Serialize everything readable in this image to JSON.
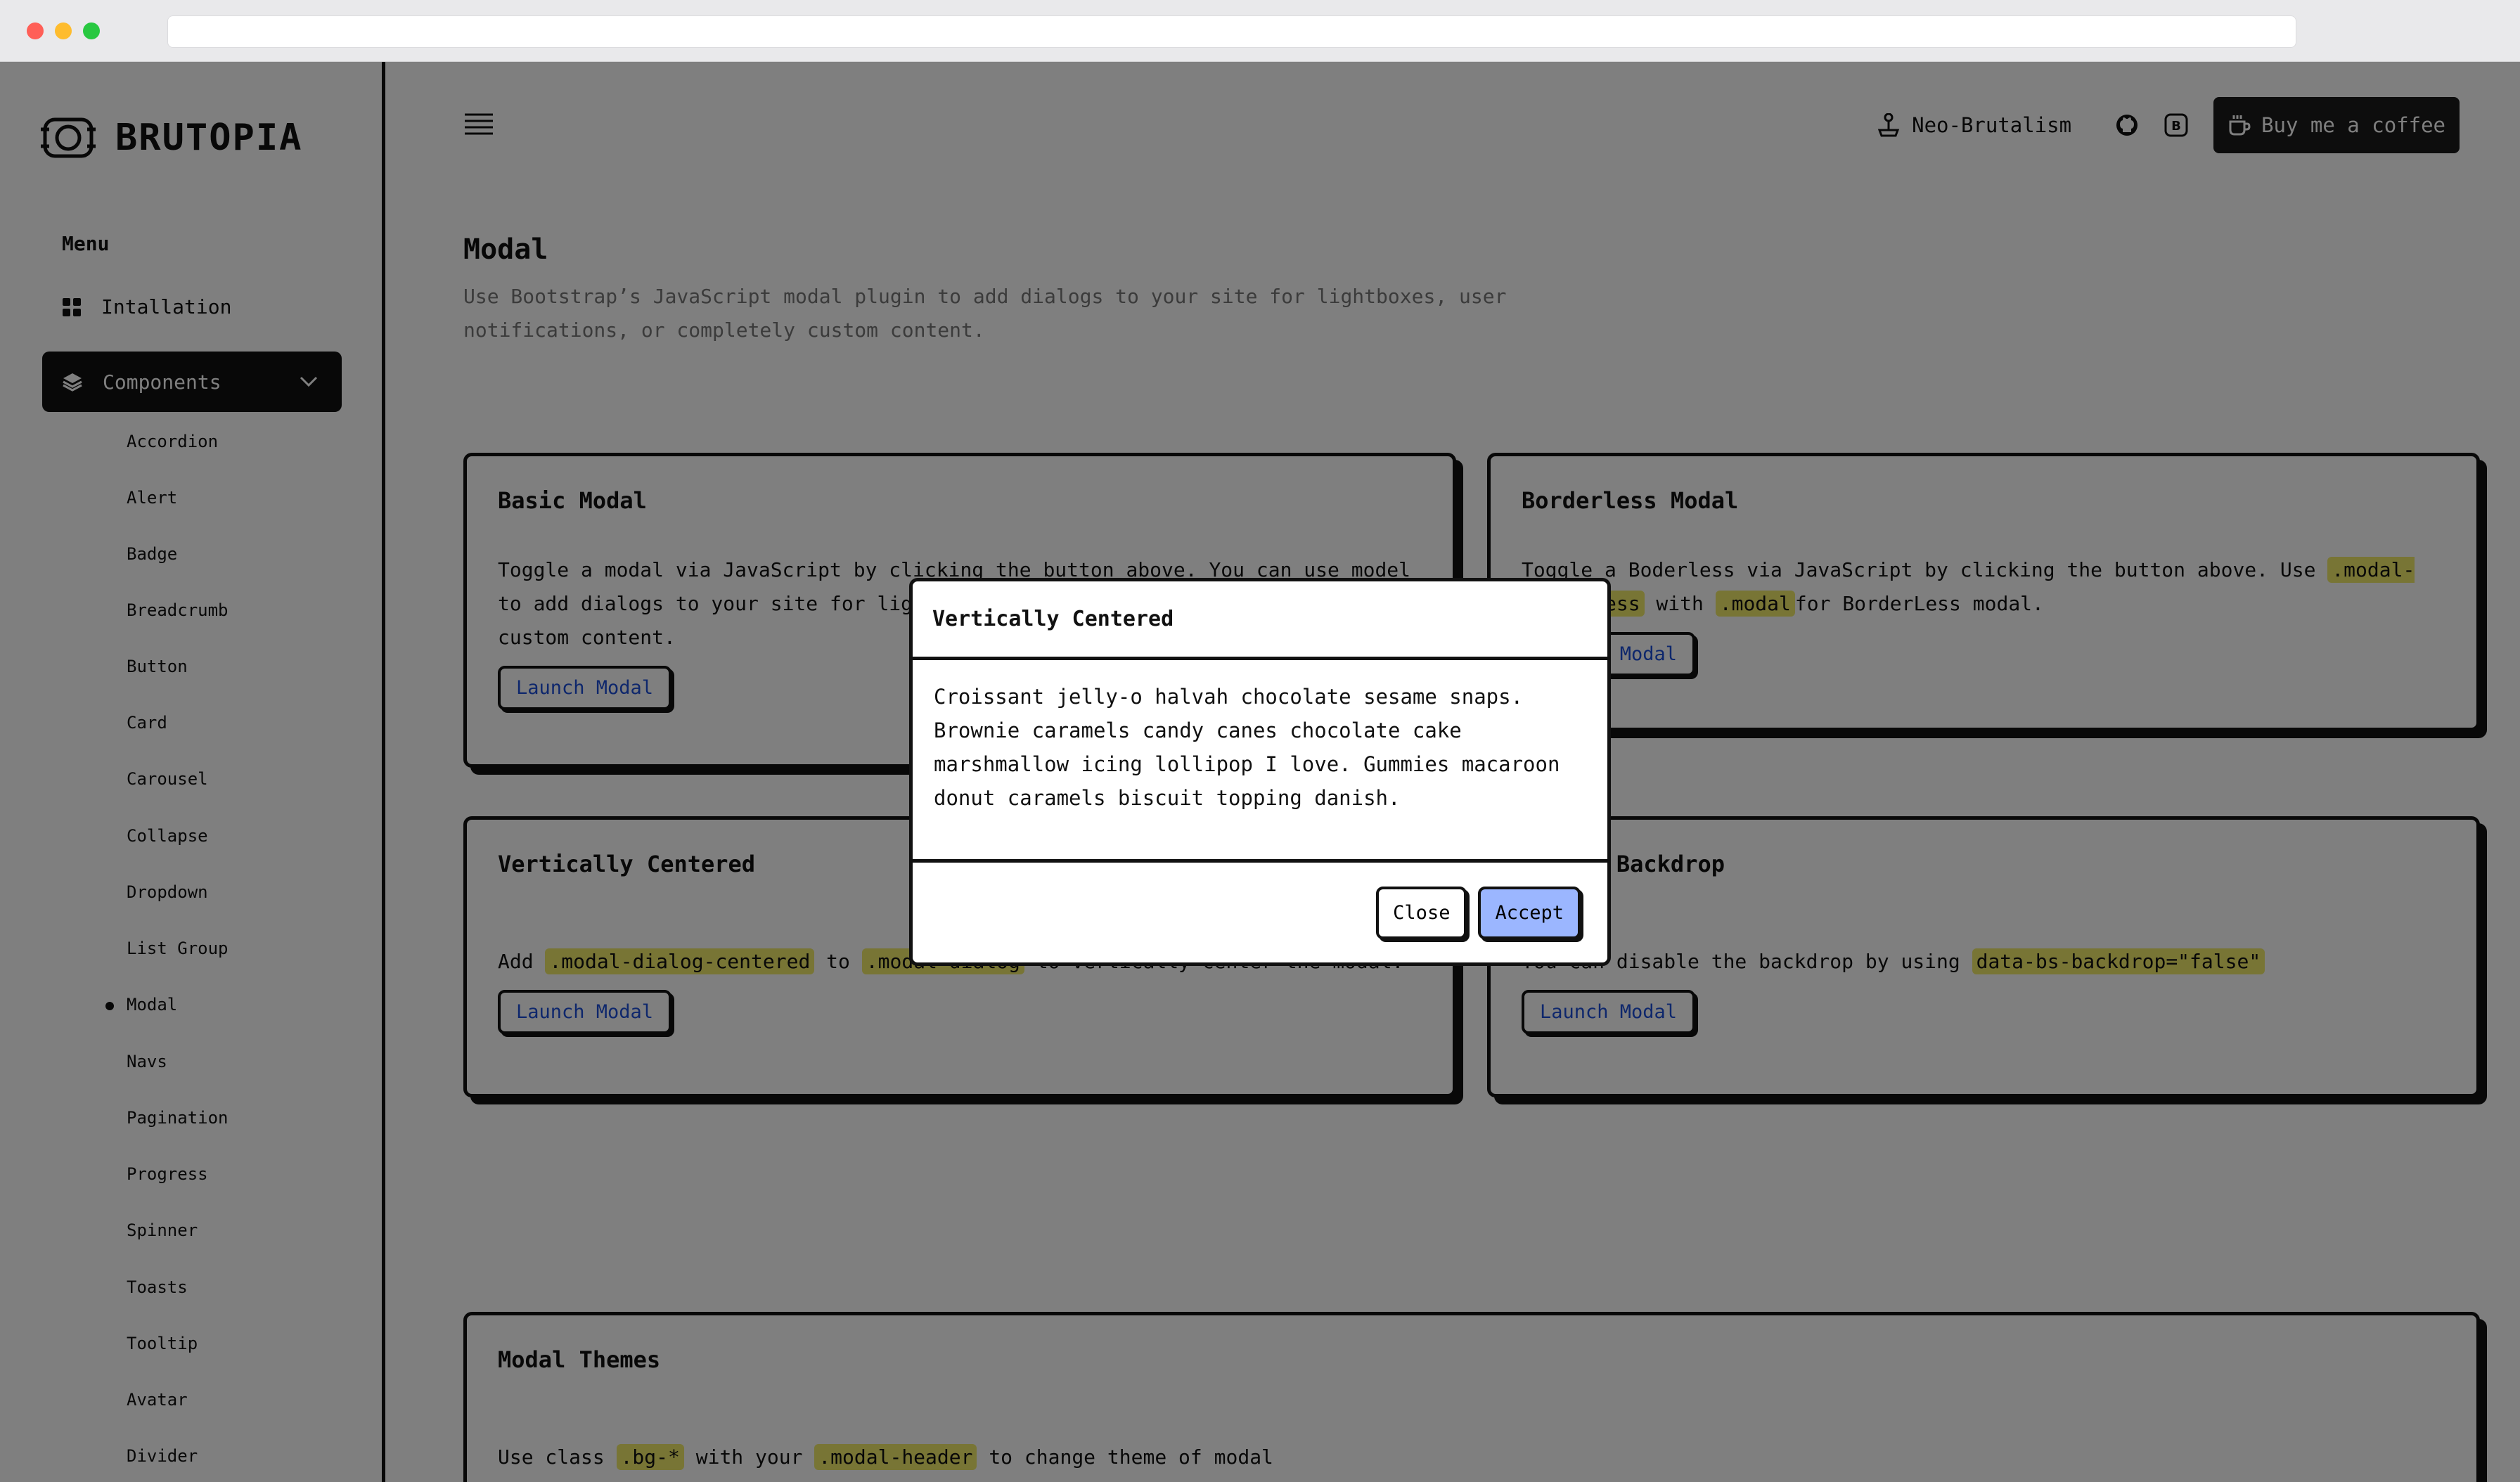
{
  "sidebar": {
    "brand": "BRUTOPIA",
    "menu_heading": "Menu",
    "installation": "Intallation",
    "components": "Components",
    "items": [
      "Accordion",
      "Alert",
      "Badge",
      "Breadcrumb",
      "Button",
      "Card",
      "Carousel",
      "Collapse",
      "Dropdown",
      "List Group",
      "Modal",
      "Navs",
      "Pagination",
      "Progress",
      "Spinner",
      "Toasts",
      "Tooltip",
      "Avatar",
      "Divider"
    ],
    "active": "Modal"
  },
  "topbar": {
    "theme_label": "Neo-Brutalism",
    "coffee_label": "Buy me a coffee"
  },
  "main": {
    "title": "Modal",
    "lead": "Use Bootstrap’s JavaScript modal plugin to add dialogs to your site for lightboxes, user notifications, or completely custom content."
  },
  "cards": {
    "basic": {
      "title": "Basic Modal",
      "text": "Toggle a modal via JavaScript by clicking the button above. You can use model to add dialogs to your site for lightboxes, user notifications, or completely custom content.",
      "button": "Launch Modal"
    },
    "borderless": {
      "title": "Borderless Modal",
      "text_pre": "Toggle a Boderless via JavaScript by clicking the button above. Use ",
      "code1": ".modal-borderless",
      "text_mid": " with ",
      "code2": ".modal",
      "text_post": "for BorderLess modal.",
      "button": "Launch Modal"
    },
    "centered": {
      "title": "Vertically Centered",
      "text_pre": "Add ",
      "code1": ".modal-dialog-centered",
      "text_mid": " to ",
      "code2": ".modal-dialog",
      "text_post": " to vertically center the modal.",
      "button": "Launch Modal"
    },
    "static": {
      "title": "Static Backdrop",
      "text_pre": "You can disable the backdrop by using ",
      "code1": "data-bs-backdrop=\"false\"",
      "button": "Launch Modal"
    },
    "themes": {
      "title": "Modal Themes",
      "text_pre": "Use class ",
      "code1": ".bg-*",
      "text_mid": " with your ",
      "code2": ".modal-header",
      "text_post": " to change theme of modal"
    }
  },
  "modal": {
    "title": "Vertically Centered",
    "body": "Croissant jelly-o halvah chocolate sesame snaps. Brownie caramels candy canes chocolate cake marshmallow icing lollipop I love. Gummies macaroon donut caramels biscuit topping danish.",
    "close": "Close",
    "accept": "Accept"
  },
  "colors": {
    "accent_button": "#9bb6ff",
    "code_highlight": "#f0ea6a",
    "link_blue": "#1d4ed8"
  }
}
